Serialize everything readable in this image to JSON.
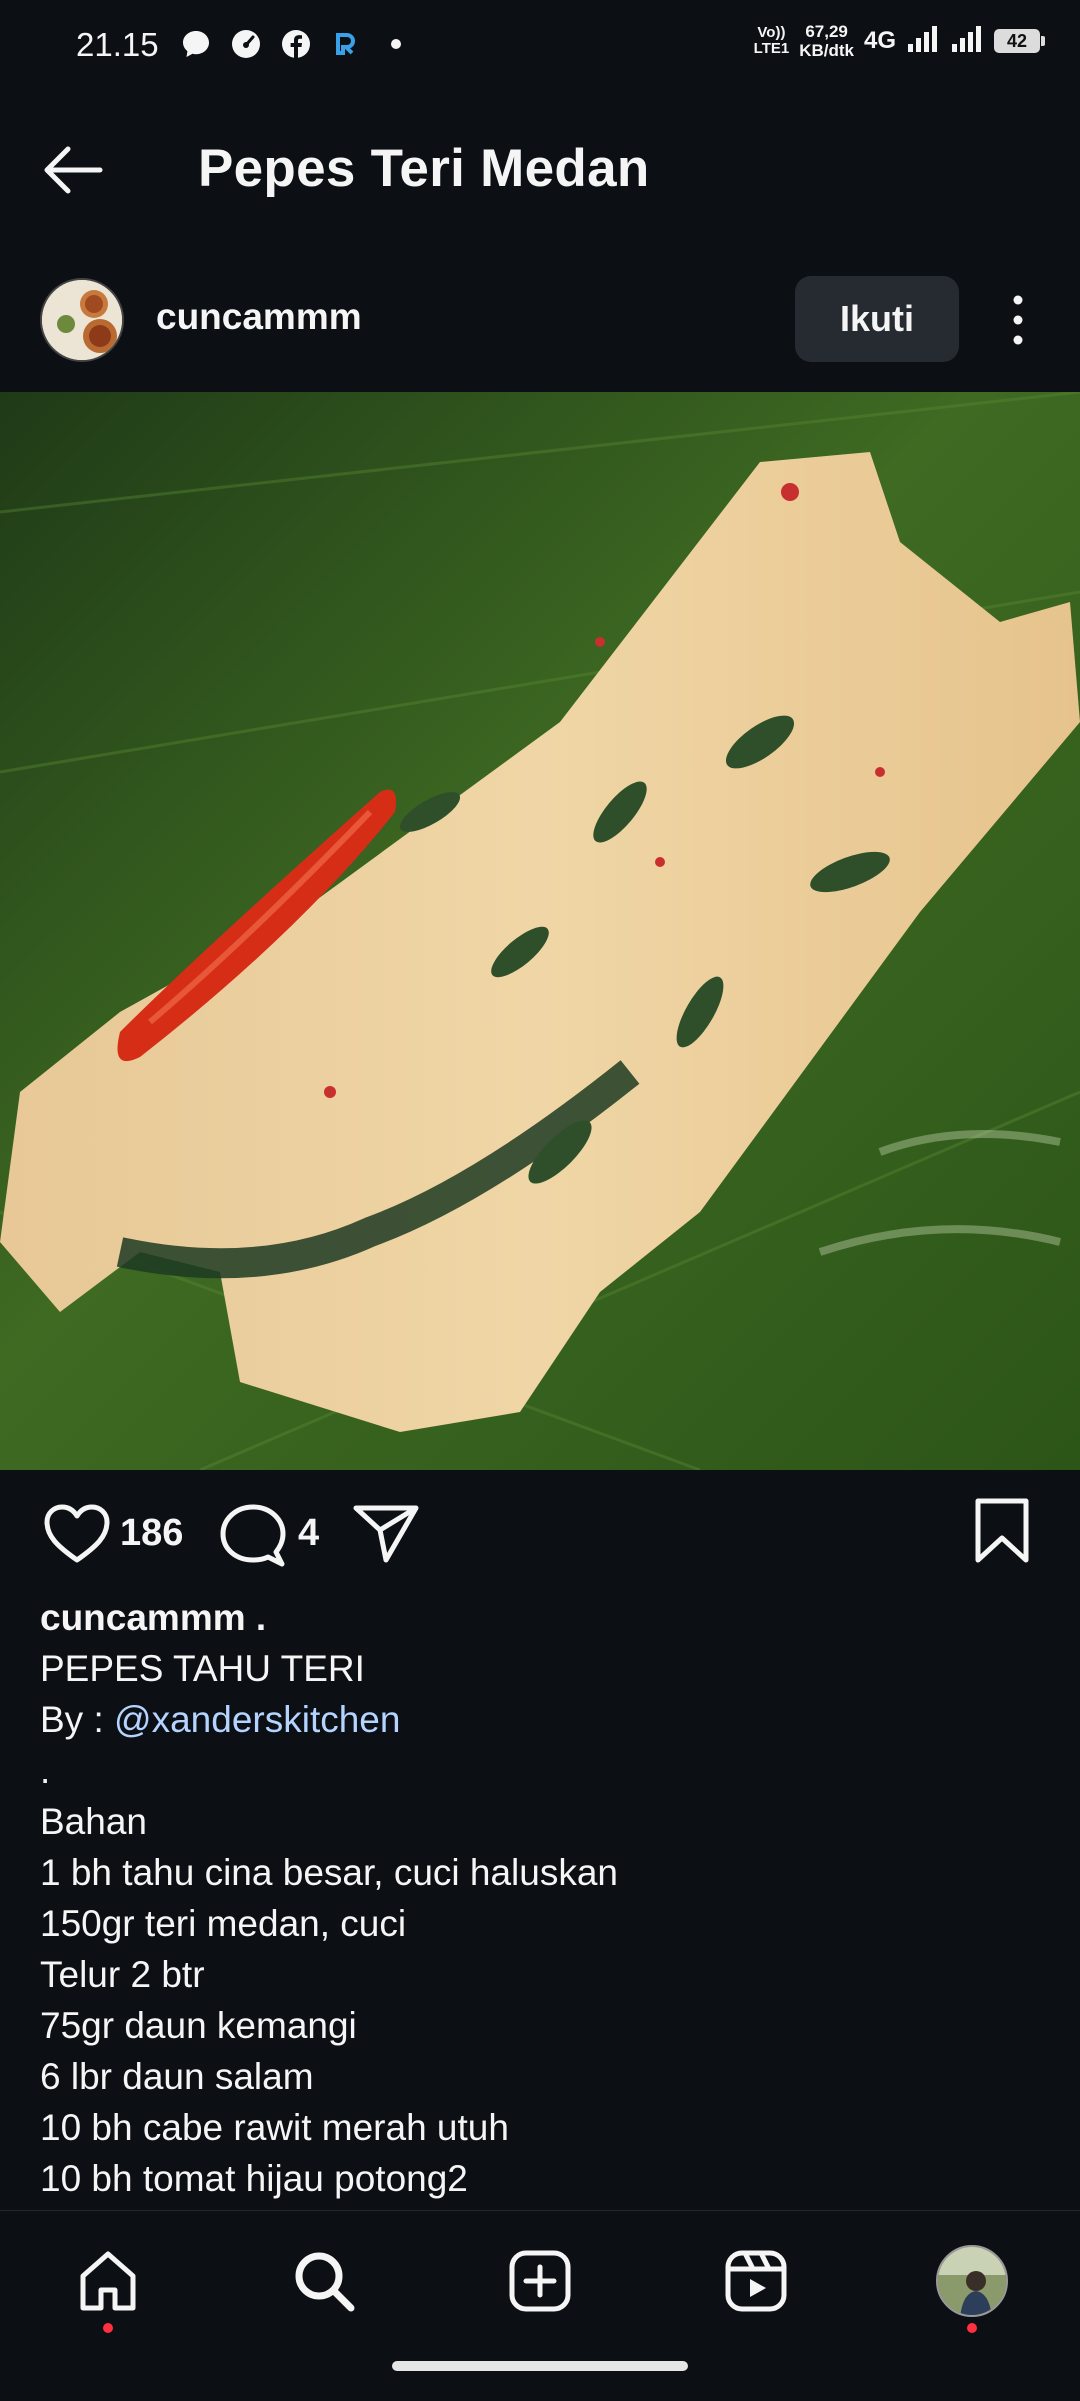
{
  "status_bar": {
    "time": "21.15",
    "volte_top": "Vo))",
    "volte_bottom": "LTE1",
    "speed_value": "67,29",
    "speed_unit": "KB/dtk",
    "network": "4G",
    "battery": "42"
  },
  "header": {
    "title": "Pepes Teri Medan"
  },
  "post": {
    "username": "cuncammm",
    "follow_label": "Ikuti",
    "likes": "186",
    "comments": "4"
  },
  "caption": {
    "user": "cuncammm .",
    "line_title": "PEPES TAHU TERI",
    "by_label": "By : ",
    "mention": "@xanderskitchen",
    "dot": ".",
    "lines": [
      "Bahan",
      "1 bh tahu cina besar, cuci haluskan",
      "150gr teri medan, cuci",
      "Telur 2 btr",
      "75gr daun kemangi",
      "6 lbr daun salam",
      "10 bh cabe rawit merah utuh",
      "10 bh tomat hijau potong2"
    ]
  },
  "nav": {
    "items": [
      "home",
      "search",
      "create",
      "reels",
      "profile"
    ]
  },
  "colors": {
    "background": "#0c1014",
    "follow_button": "#262b31",
    "mention": "#b4d4ff",
    "notification_dot": "#ff3040"
  }
}
